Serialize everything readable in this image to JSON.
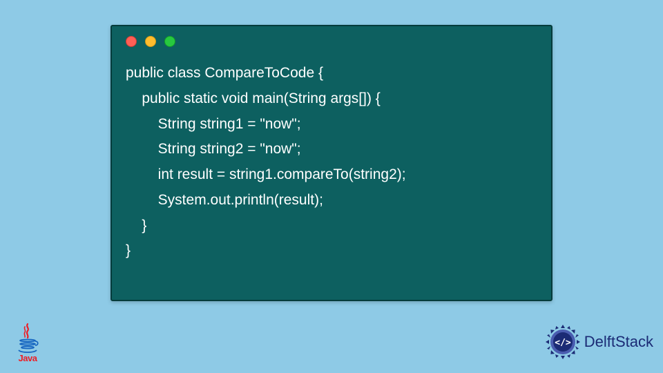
{
  "code": {
    "lines": [
      "public class CompareToCode {",
      "    public static void main(String args[]) {",
      "        String string1 = \"now\";",
      "        String string2 = \"now\";",
      "        int result = string1.compareTo(string2);",
      "        System.out.println(result);",
      "    }",
      "}"
    ]
  },
  "logos": {
    "java_label": "Java",
    "delft_label": "DelftStack"
  },
  "colors": {
    "background": "#8ecae6",
    "window_bg": "#0d6060",
    "window_border": "#053b3b",
    "code_text": "#ffffff",
    "dot_red": "#ff5f56",
    "dot_yellow": "#ffbd2e",
    "dot_green": "#27c93f",
    "java_red": "#ed1c24",
    "java_blue": "#1565c0",
    "delft_blue": "#1b2b75"
  }
}
